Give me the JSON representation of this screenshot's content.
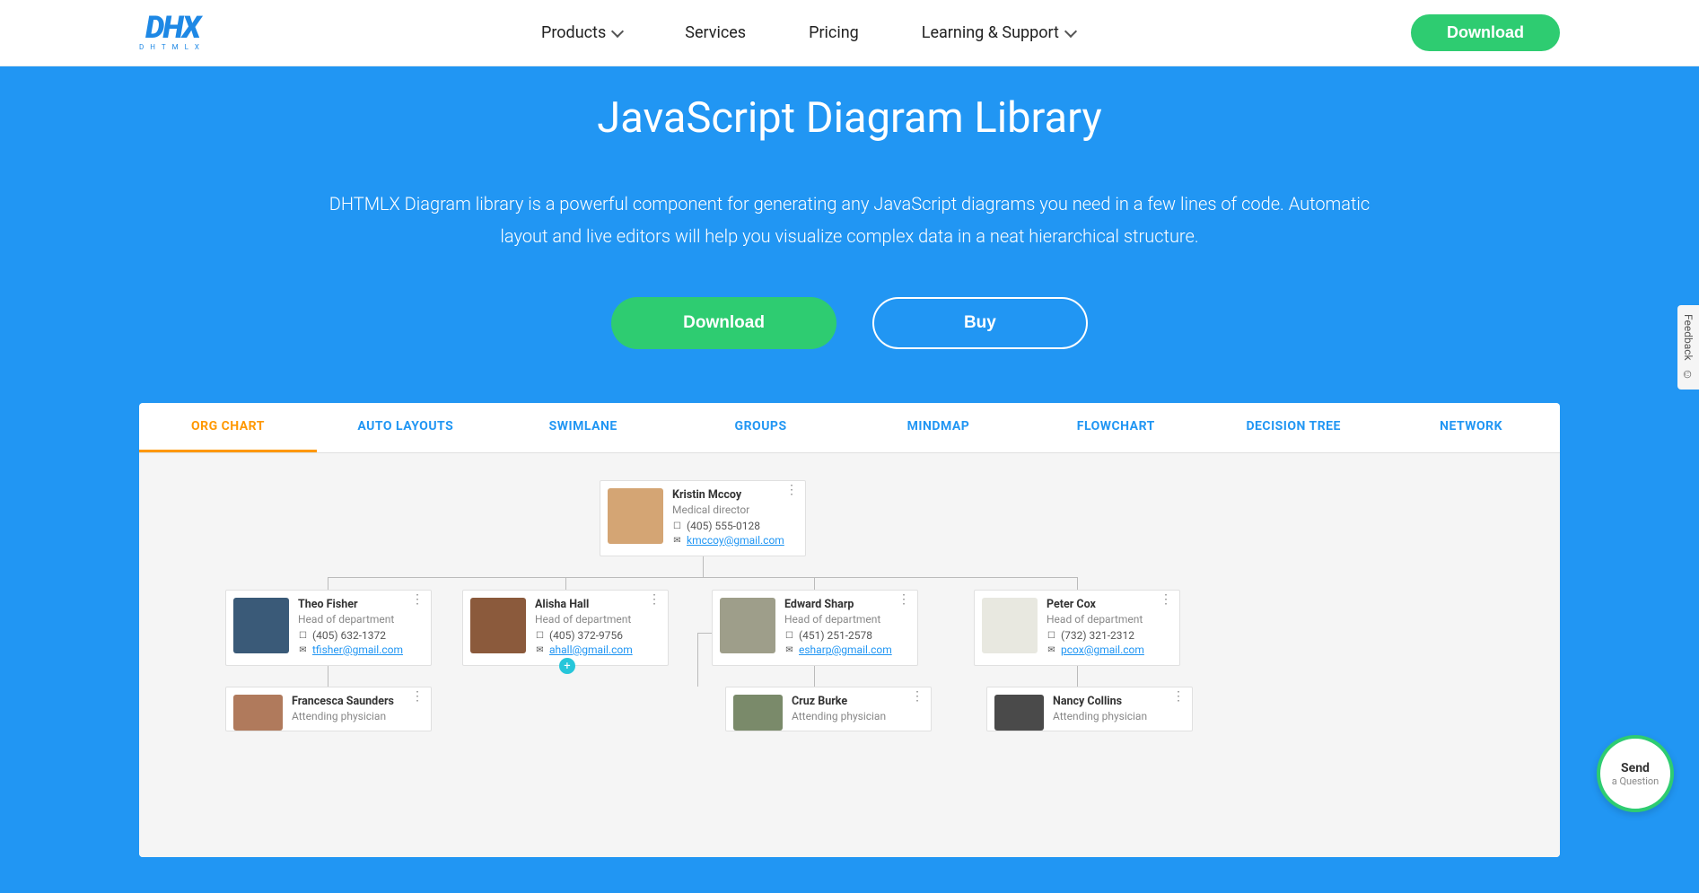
{
  "header": {
    "logo_main": "DHX",
    "logo_sub": "DHTMLX",
    "nav": [
      "Products",
      "Services",
      "Pricing",
      "Learning & Support"
    ],
    "download": "Download"
  },
  "hero": {
    "title": "JavaScript Diagram Library",
    "desc": "DHTMLX Diagram library is a powerful component for generating any JavaScript diagrams you need in a few lines of code. Automatic layout and live editors will help you visualize complex data in a neat hierarchical structure.",
    "download": "Download",
    "buy": "Buy"
  },
  "tabs": [
    "ORG CHART",
    "AUTO LAYOUTS",
    "SWIMLANE",
    "GROUPS",
    "MINDMAP",
    "FLOWCHART",
    "DECISION TREE",
    "NETWORK"
  ],
  "cards": {
    "root": {
      "name": "Kristin Mccoy",
      "title": "Medical director",
      "phone": "(405) 555-0128",
      "email": "kmccoy@gmail.com",
      "avatar": "#d4a574"
    },
    "c1": {
      "name": "Theo Fisher",
      "title": "Head of department",
      "phone": "(405) 632-1372",
      "email": "tfisher@gmail.com",
      "avatar": "#3a5a78"
    },
    "c2": {
      "name": "Alisha Hall",
      "title": "Head of department",
      "phone": "(405) 372-9756",
      "email": "ahall@gmail.com",
      "avatar": "#8b5a3c"
    },
    "c3": {
      "name": "Edward Sharp",
      "title": "Head of department",
      "phone": "(451) 251-2578",
      "email": "esharp@gmail.com",
      "avatar": "#9e9e8a"
    },
    "c4": {
      "name": "Peter Cox",
      "title": "Head of department",
      "phone": "(732) 321-2312",
      "email": "pcox@gmail.com",
      "avatar": "#e8e8e0"
    },
    "c5": {
      "name": "Francesca Saunders",
      "title": "Attending physician",
      "phone": "",
      "email": "",
      "avatar": "#b07a5c"
    },
    "c6": {
      "name": "Cruz Burke",
      "title": "Attending physician",
      "phone": "",
      "email": "",
      "avatar": "#7a8a6a"
    },
    "c7": {
      "name": "Nancy Collins",
      "title": "Attending physician",
      "phone": "",
      "email": "",
      "avatar": "#4a4a4a"
    }
  },
  "feedback": "Feedback",
  "chat": {
    "send": "Send",
    "q": "a Question"
  }
}
